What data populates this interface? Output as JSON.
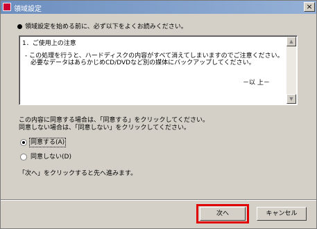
{
  "window": {
    "title": "領域設定"
  },
  "intro": "領域設定を始める前に、必ず以下をよくお読みください。",
  "notice": {
    "heading": "1．ご使用上の注意",
    "line1": "- この処理を行うと、ハードディスクの内容がすべて消えてしまいますのでご注意ください。",
    "line2": "必要なデータはあらかじめCD/DVDなど別の媒体にバックアップしてください。",
    "end": "－以 上－"
  },
  "agreement": {
    "text1": "この内容に同意する場合は、「同意する」をクリックしてください。",
    "text2": "同意しない場合は、「同意しない」をクリックしてください。",
    "options": [
      {
        "label": "同意する(A)",
        "checked": true
      },
      {
        "label": "同意しない(D)",
        "checked": false
      }
    ]
  },
  "hint": "「次へ」をクリックすると先へ進みます。",
  "buttons": {
    "next": "次へ",
    "cancel": "キャンセル"
  },
  "icons": {
    "close": "×",
    "scroll_up": "▲",
    "scroll_down": "▼"
  },
  "colors": {
    "highlight": "#e00000"
  }
}
